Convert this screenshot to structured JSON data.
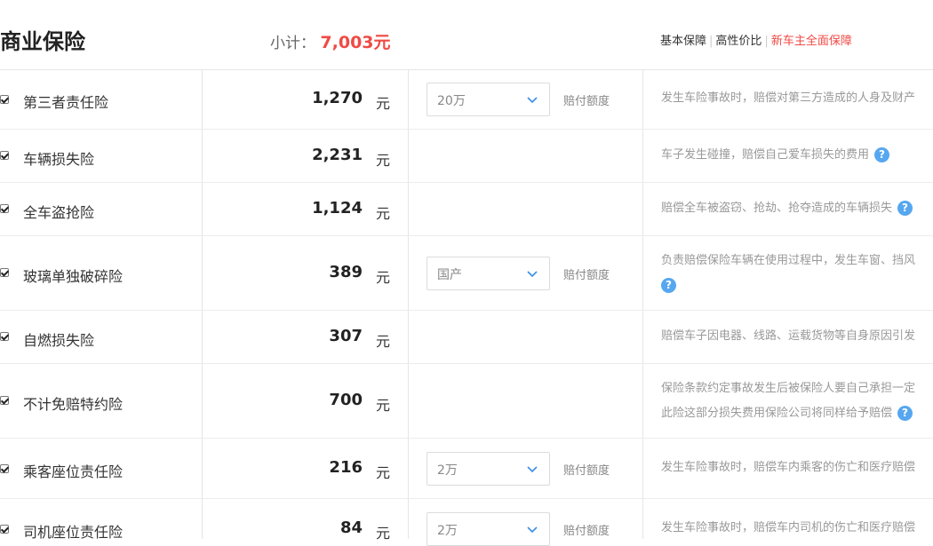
{
  "header": {
    "title": "商业保险",
    "subtotal_label": "小计：",
    "subtotal_value": "7,003元",
    "plans": [
      "基本保障",
      "高性价比",
      "新车主全面保障"
    ]
  },
  "unit": "元",
  "rows": [
    {
      "name": "第三者责任险",
      "price": "1,270",
      "select": "20万",
      "select_label": "赔付额度",
      "desc": [
        "发生车险事故时，赔偿对第三方造成的人身及财产"
      ]
    },
    {
      "name": "车辆损失险",
      "price": "2,231",
      "desc": [
        "车子发生碰撞，赔偿自己爱车损失的费用"
      ]
    },
    {
      "name": "全车盗抢险",
      "price": "1,124",
      "desc": [
        "赔偿全车被盗窃、抢劫、抢夺造成的车辆损失"
      ]
    },
    {
      "name": "玻璃单独破碎险",
      "price": "389",
      "select": "国产",
      "select_label": "赔付额度",
      "desc": [
        "负责赔偿保险车辆在使用过程中，发生车窗、挡风"
      ]
    },
    {
      "name": "自燃损失险",
      "price": "307",
      "desc": [
        "赔偿车子因电器、线路、运载货物等自身原因引发"
      ]
    },
    {
      "name": "不计免赔特约险",
      "price": "700",
      "desc": [
        "保险条款约定事故发生后被保险人要自己承担一定",
        "此险这部分损失费用保险公司将同样给予赔偿"
      ]
    },
    {
      "name": "乘客座位责任险",
      "price": "216",
      "select": "2万",
      "select_label": "赔付额度",
      "desc": [
        "发生车险事故时，赔偿车内乘客的伤亡和医疗赔偿"
      ]
    },
    {
      "name": "司机座位责任险",
      "price": "84",
      "select": "2万",
      "select_label": "赔付额度",
      "desc": [
        "发生车险事故时，赔偿车内司机的伤亡和医疗赔偿"
      ]
    }
  ],
  "icons": {
    "checkbox": "checkbox-checked-icon",
    "help": "question-circle-icon",
    "chevron": "chevron-down-icon"
  },
  "colors": {
    "accent": "#f04a44",
    "help": "#56a7f0"
  }
}
